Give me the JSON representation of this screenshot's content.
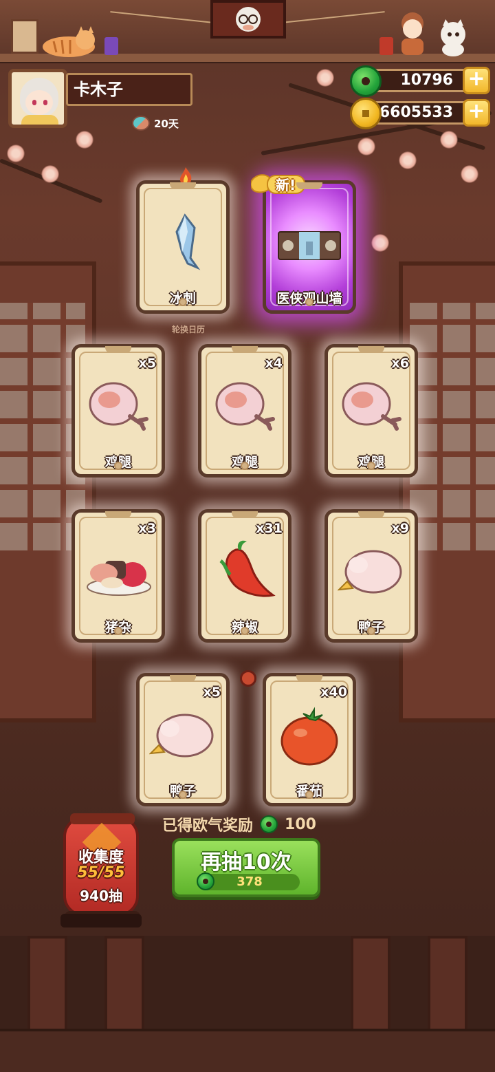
{
  "player": {
    "name": "卡木子",
    "days": "20天"
  },
  "resources": {
    "jade": "10796",
    "coins": "6605533"
  },
  "calendar_label": "轮换日历",
  "featured_cards": [
    {
      "name": "冰刺",
      "count": "",
      "rare": false,
      "art": "ice-shard-icon"
    },
    {
      "name": "医侠观山墙",
      "count": "",
      "rare": true,
      "badge": "新!",
      "art": "wall-screen-icon"
    }
  ],
  "cards": [
    {
      "name": "鸡腿",
      "count": "x5",
      "art": "drumstick-icon"
    },
    {
      "name": "鸡腿",
      "count": "x4",
      "art": "drumstick-icon"
    },
    {
      "name": "鸡腿",
      "count": "x6",
      "art": "drumstick-icon"
    },
    {
      "name": "猪杂",
      "count": "x3",
      "art": "pork-offal-icon"
    },
    {
      "name": "辣椒",
      "count": "x31",
      "art": "chili-icon"
    },
    {
      "name": "鸭子",
      "count": "x9",
      "art": "duck-icon"
    },
    {
      "name": "鸭子",
      "count": "x5",
      "art": "duck-icon"
    },
    {
      "name": "番茄",
      "count": "x40",
      "art": "tomato-icon"
    }
  ],
  "reward": {
    "label": "已得欧气奖励",
    "amount": "100"
  },
  "draw_button": {
    "label": "再抽10次",
    "cost": "378"
  },
  "collection": {
    "title": "收集度",
    "progress": "55/55",
    "draws": "940抽"
  },
  "colors": {
    "accent_green": "#5fb42c",
    "rare_purple": "#b23ed8",
    "card_bg": "#f2e2be",
    "lantern_red": "#b22a24"
  }
}
